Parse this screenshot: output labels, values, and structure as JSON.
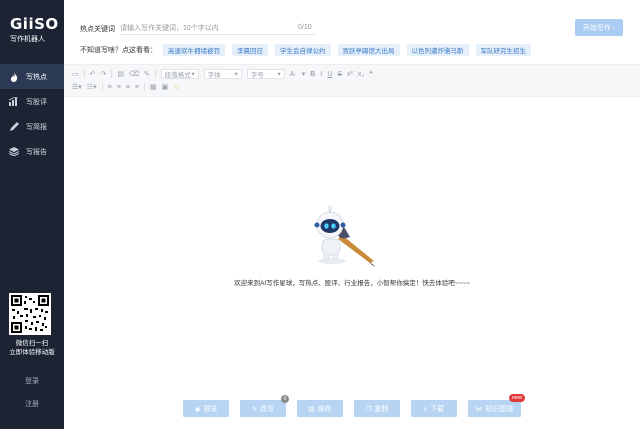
{
  "app": {
    "logo": "GiiSO",
    "logo_sub": "写作机器人"
  },
  "sidebar": {
    "items": [
      {
        "label": "写热点",
        "icon": "flame-icon"
      },
      {
        "label": "写股评",
        "icon": "chart-icon"
      },
      {
        "label": "写简报",
        "icon": "pen-icon"
      },
      {
        "label": "写报告",
        "icon": "layers-icon"
      }
    ],
    "qr_text_1": "微信扫一扫",
    "qr_text_2": "立即体验移动版",
    "login": "登录",
    "register": "注册"
  },
  "top": {
    "keyword_label": "热点关键词",
    "keyword_placeholder": "请输入写作关键词，10个字以内",
    "keyword_count": "0/10",
    "start_button": "开始写作 ›",
    "hint_label": "不知道写啥？点这看看：",
    "tags": [
      "高速欢牛拥堵被罚",
      "李晨回应",
      "学生会自律公约",
      "贾跃亭踢馆大出局",
      "以色列遭炸骆马斯",
      "军队研究生招生"
    ]
  },
  "toolbar": {
    "paragraph_format": "段落格式",
    "font_family": "字体",
    "font_size": "字号"
  },
  "editor": {
    "welcome": "欢迎来到AI写作星球，写热点、股评、行业报告，小智帮你搞定！快去体验吧~~~~"
  },
  "actions": [
    {
      "label": "预览",
      "icon": "eye-icon"
    },
    {
      "label": "改写",
      "icon": "edit-icon",
      "badge": "0"
    },
    {
      "label": "保存",
      "icon": "save-icon"
    },
    {
      "label": "复制",
      "icon": "copy-icon"
    },
    {
      "label": "下载",
      "icon": "download-icon"
    },
    {
      "label": "知识图谱",
      "icon": "graph-icon",
      "badge": "new"
    }
  ],
  "colors": {
    "sidebar_bg": "#1c2333",
    "sidebar_active": "#2d3a55",
    "button_bg": "#b7d5f3",
    "tag_bg": "#e6f0fb",
    "tag_text": "#3b7bc4",
    "badge_new": "#e03b3b"
  }
}
